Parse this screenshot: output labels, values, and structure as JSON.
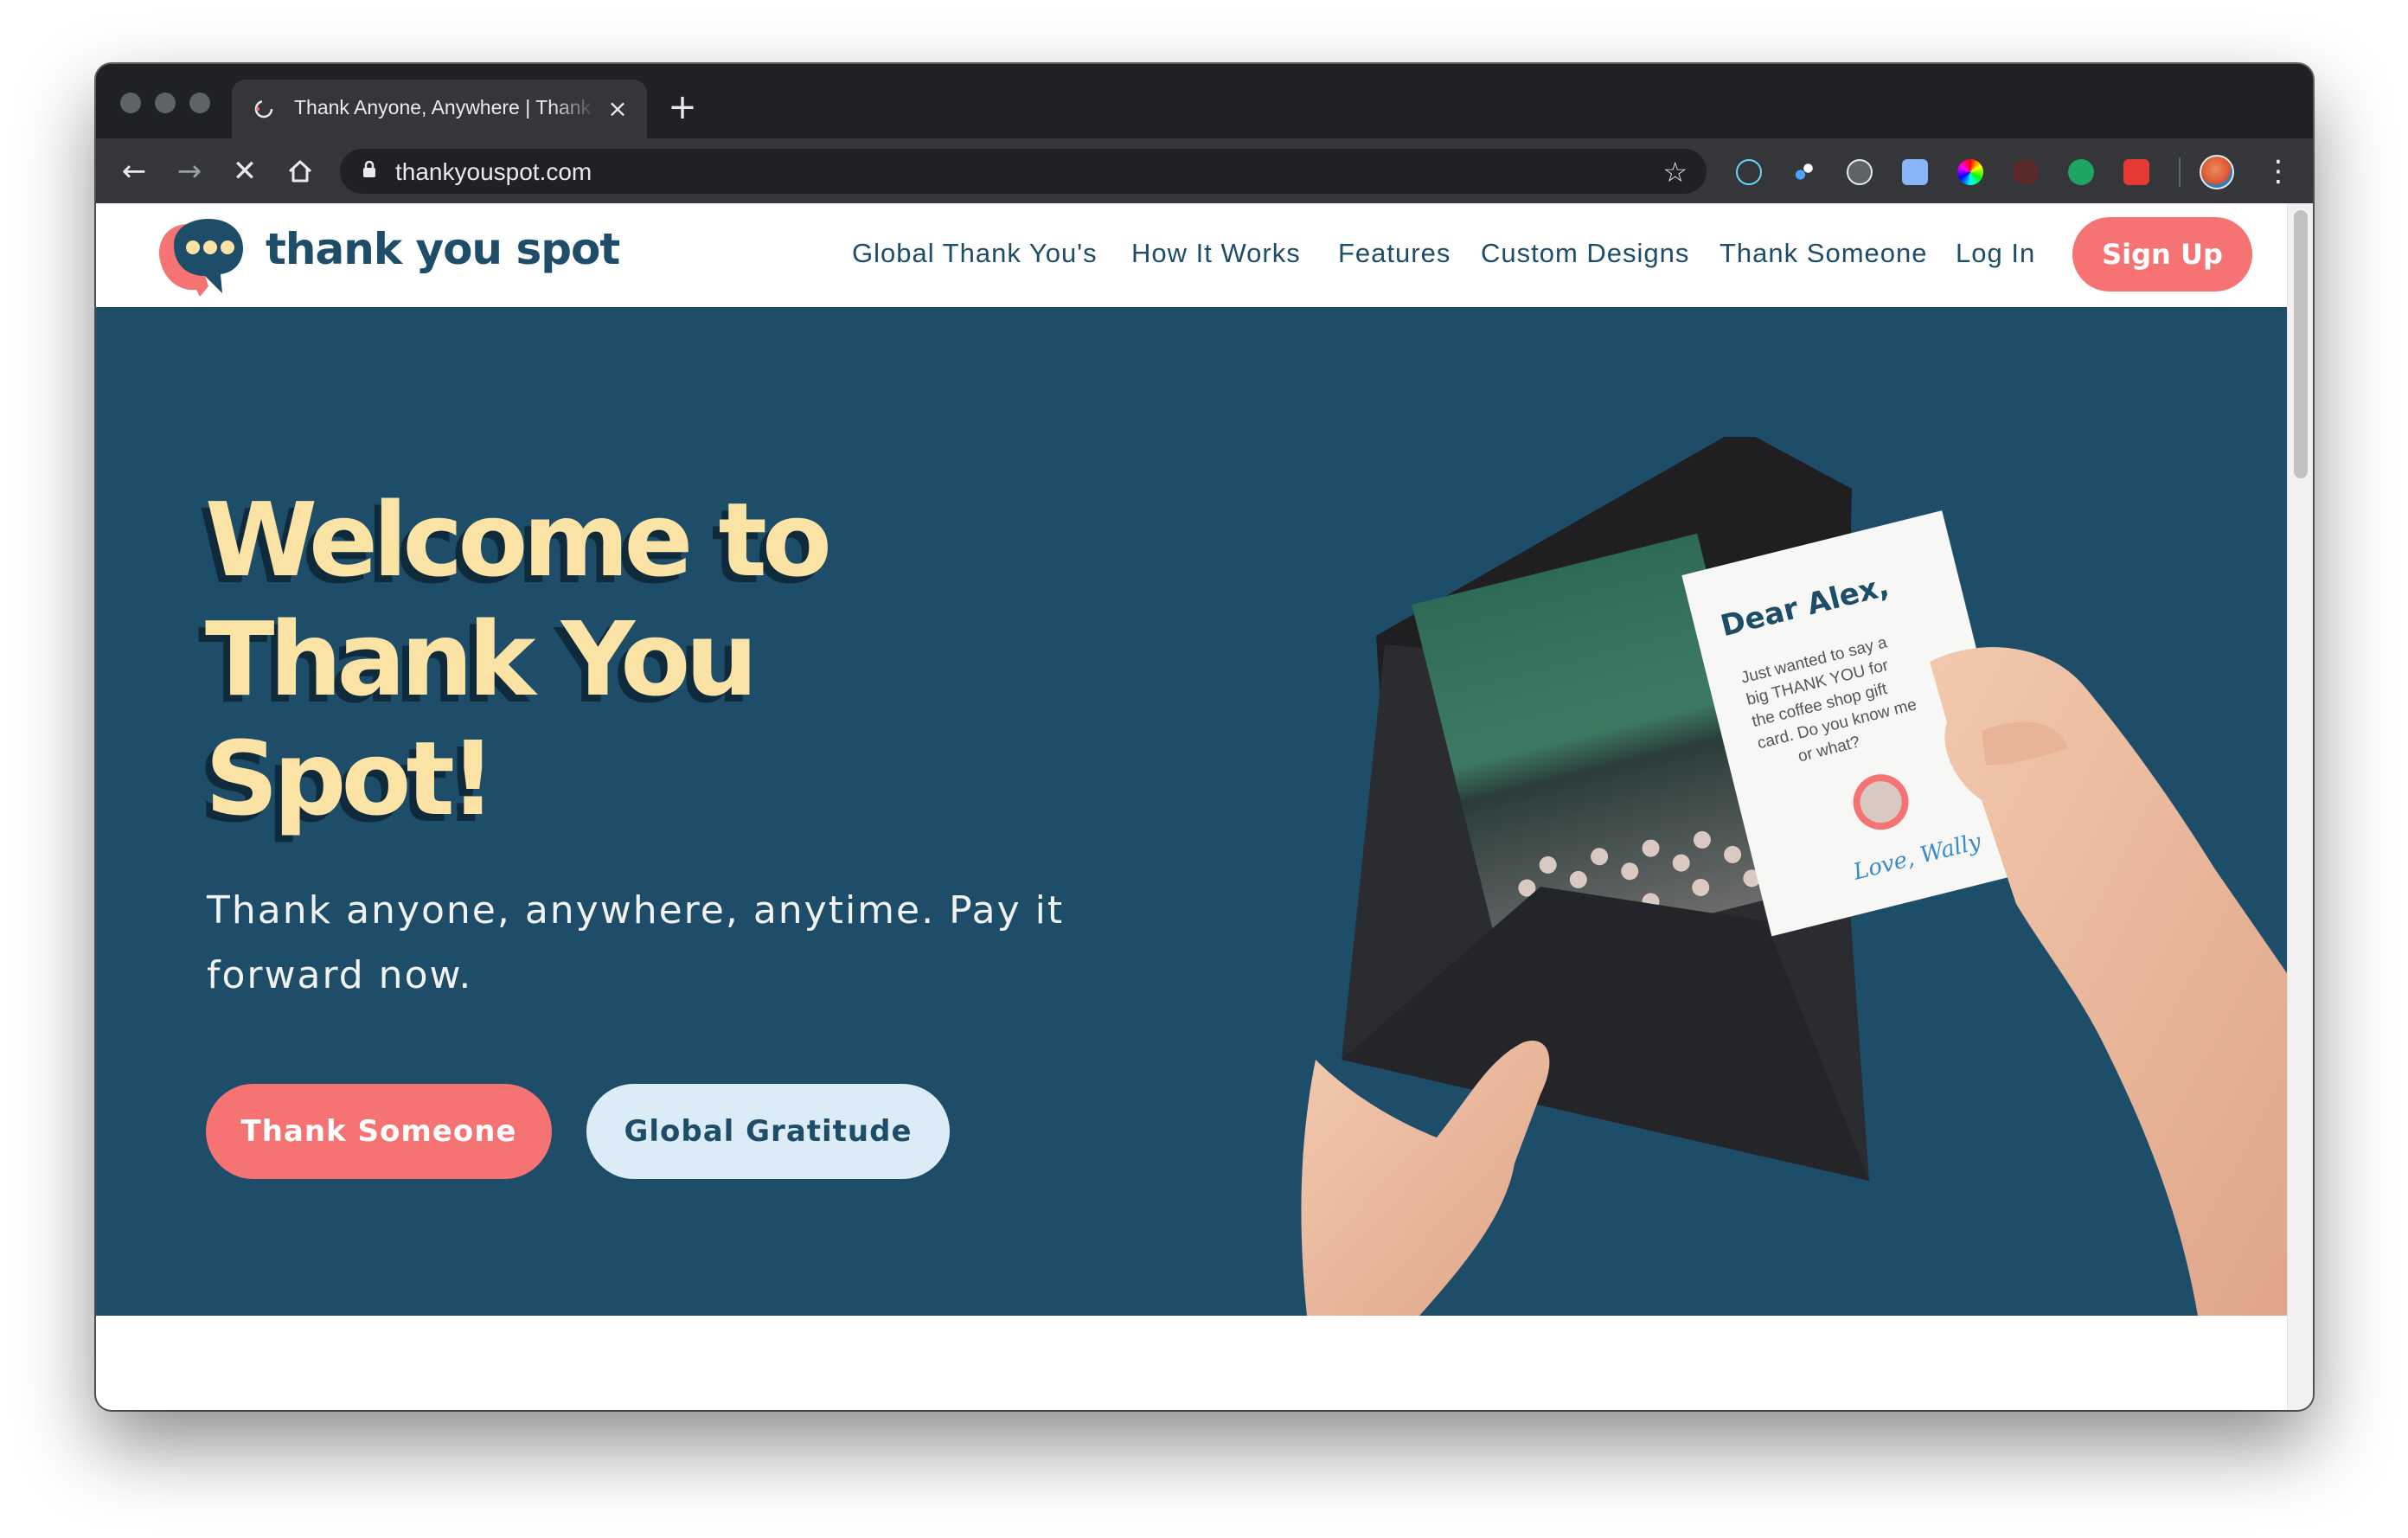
{
  "browser": {
    "tab_title": "Thank Anyone, Anywhere | Thank You Spot",
    "url": "thankyouspot.com",
    "controls": {
      "back": "back-icon",
      "forward": "forward-icon",
      "stop": "stop-icon",
      "home": "home-icon"
    },
    "extensions": [
      "react-devtools-icon",
      "extension-dots-icon",
      "wordpress-icon",
      "calendar-icon",
      "color-wheel-icon",
      "heart-extension-icon",
      "green-dot-icon",
      "video-extension-icon"
    ]
  },
  "site": {
    "logo_text": "thank you spot",
    "nav": [
      "Global Thank You's",
      "How It Works",
      "Features",
      "Custom Designs",
      "Thank Someone",
      "Log In"
    ],
    "signup_label": "Sign Up"
  },
  "hero": {
    "title_lines": [
      "Welcome to",
      "Thank You",
      "Spot!"
    ],
    "subtitle_lines": [
      "Thank anyone, anywhere, anytime. Pay it",
      "forward now."
    ],
    "cta_primary": "Thank Someone",
    "cta_secondary": "Global Gratitude"
  },
  "card": {
    "greeting": "Dear Alex,",
    "body_lines": [
      "Just wanted to say a",
      "big THANK YOU for",
      "the coffee shop gift",
      "card. Do you know me",
      "or what?"
    ],
    "signature": "Love, Wally"
  },
  "colors": {
    "brand_navy": "#1d4d68",
    "brand_coral": "#f57373",
    "hero_title": "#fbe3a6",
    "secondary_button": "#dcecf6"
  }
}
